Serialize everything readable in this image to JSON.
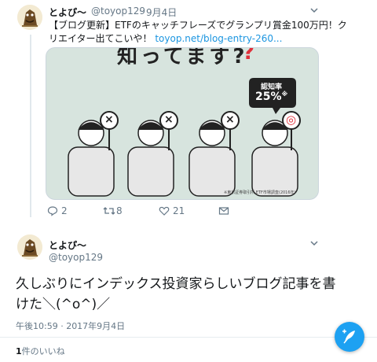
{
  "tweet1": {
    "name": "とよぴ～",
    "handle": "@toyop129",
    "date": "9月4日",
    "text_line1": "【ブログ更新】ETFのキャッチフレーズでグランプリ賞金100万円！ク",
    "text_line2_prefix": "リエイター出てこいや！ ",
    "link": "toyop.net/blog-entry-260...",
    "card": {
      "headline": "知ってます?",
      "speech_label": "認知率",
      "speech_value": "25%",
      "speech_sup": "※",
      "footnote": "※東京証券取引所 ETF市場調査(2016年)",
      "signs": [
        "×",
        "×",
        "×",
        "◎"
      ]
    },
    "replies": "2",
    "retweets": "8",
    "likes": "21"
  },
  "tweet2": {
    "name": "とよぴ～",
    "handle": "@toyop129",
    "text_line1": "久しぶりにインデックス投資家らしいブログ記事を書",
    "text_line2": "けた＼(^o^)／",
    "timestamp": "午後10:59 · 2017年9月4日",
    "likes_count": "1",
    "likes_label": "件のいいね"
  },
  "colors": {
    "accent": "#1da1f2",
    "link": "#1b95e0",
    "card_bg": "#d7e4de",
    "heart": "#e0245e"
  }
}
